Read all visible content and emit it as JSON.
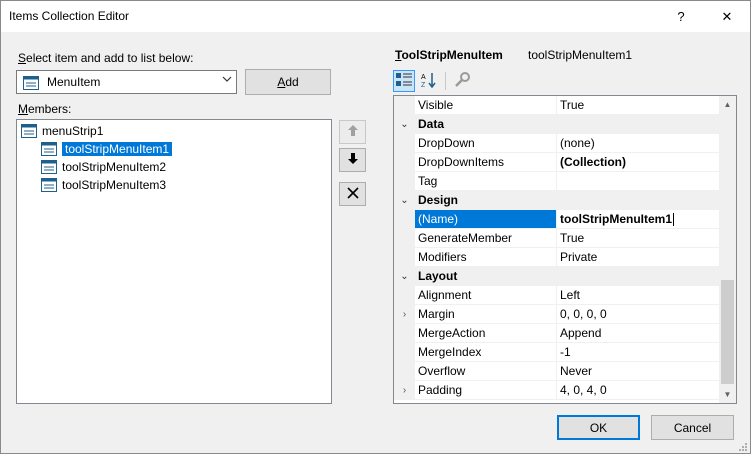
{
  "window": {
    "title": "Items Collection Editor",
    "help_glyph": "?",
    "close_glyph": "✕"
  },
  "select_label_prefix": "S",
  "select_label_rest": "elect item and add to list below:",
  "combo": {
    "value": "MenuItem"
  },
  "add_button": {
    "mnemonic": "A",
    "rest": "dd"
  },
  "members_label_prefix": "M",
  "members_label_rest": "embers:",
  "members": {
    "root": "menuStrip1",
    "items": [
      {
        "label": "toolStripMenuItem1",
        "selected": true
      },
      {
        "label": "toolStripMenuItem2",
        "selected": false
      },
      {
        "label": "toolStripMenuItem3",
        "selected": false
      }
    ]
  },
  "side_buttons": {
    "up": "🡅",
    "down": "🡇",
    "delete": "✕"
  },
  "property_header": {
    "type_mnemonic": "T",
    "type_rest": "oolStripMenuItem",
    "name": "toolStripMenuItem1"
  },
  "toolbar": {
    "categorized_icon": "categorized-icon",
    "alphabetical_icon": "alphabetical-icon",
    "property_pages_icon": "wrench-icon"
  },
  "grid": {
    "rows": [
      {
        "kind": "prop",
        "name": "Visible",
        "value": "True"
      },
      {
        "kind": "cat",
        "name": "Data",
        "glyph": "⌄"
      },
      {
        "kind": "prop",
        "name": "DropDown",
        "value": "(none)"
      },
      {
        "kind": "prop",
        "name": "DropDownItems",
        "value": "(Collection)",
        "bold": true
      },
      {
        "kind": "prop",
        "name": "Tag",
        "value": ""
      },
      {
        "kind": "cat",
        "name": "Design",
        "glyph": "⌄"
      },
      {
        "kind": "prop",
        "name": "(Name)",
        "value": "toolStripMenuItem1",
        "selected": true
      },
      {
        "kind": "prop",
        "name": "GenerateMember",
        "value": "True"
      },
      {
        "kind": "prop",
        "name": "Modifiers",
        "value": "Private"
      },
      {
        "kind": "cat",
        "name": "Layout",
        "glyph": "⌄"
      },
      {
        "kind": "prop",
        "name": "Alignment",
        "value": "Left"
      },
      {
        "kind": "prop",
        "name": "Margin",
        "value": "0, 0, 0, 0",
        "expander": "›"
      },
      {
        "kind": "prop",
        "name": "MergeAction",
        "value": "Append"
      },
      {
        "kind": "prop",
        "name": "MergeIndex",
        "value": "-1"
      },
      {
        "kind": "prop",
        "name": "Overflow",
        "value": "Never"
      },
      {
        "kind": "prop",
        "name": "Padding",
        "value": "4, 0, 4, 0",
        "expander": "›"
      }
    ]
  },
  "scroll": {
    "up": "▲",
    "down": "▼"
  },
  "buttons": {
    "ok": "OK",
    "cancel": "Cancel"
  },
  "colors": {
    "selection": "#0078d7",
    "window_bg": "#f0f0f0"
  }
}
